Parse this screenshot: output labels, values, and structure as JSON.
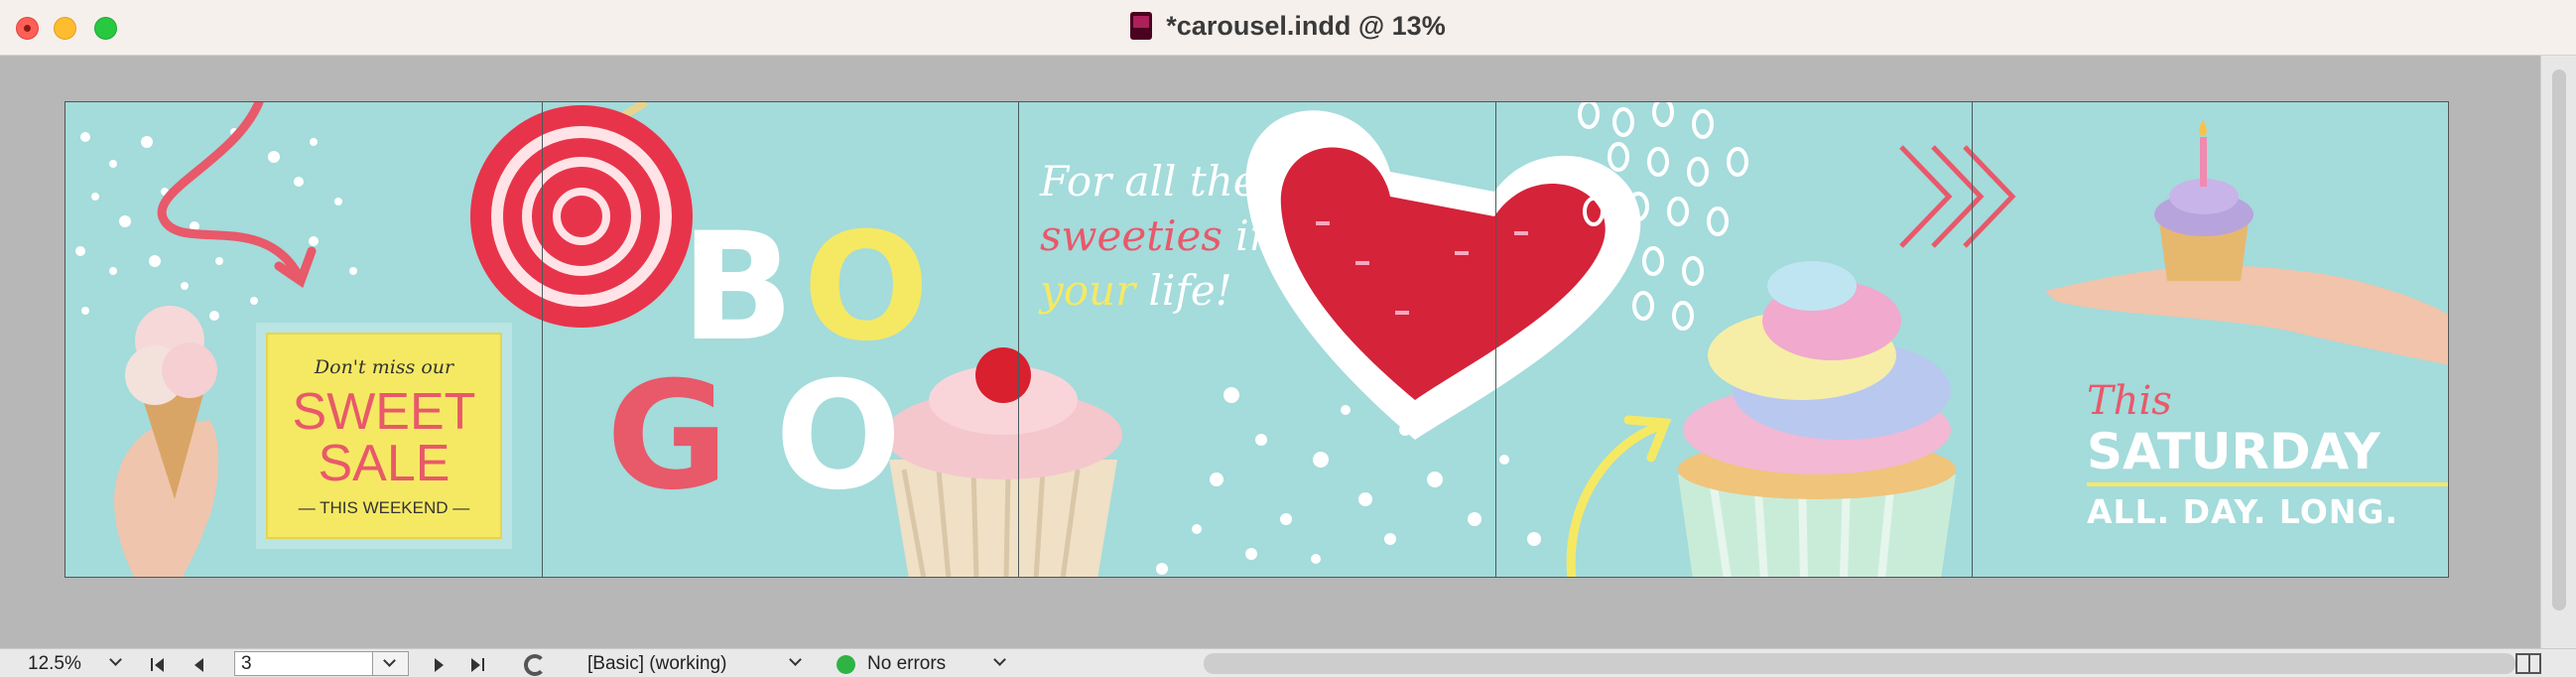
{
  "window": {
    "title": "*carousel.indd @ 13%"
  },
  "artwork": {
    "sale_card": {
      "top_line": "Don't miss our",
      "line1": "SWEET",
      "line2": "SALE",
      "bottom_line": "— THIS WEEKEND —"
    },
    "bogo": {
      "b": "B",
      "o1": "O",
      "g": "G",
      "o2": "O"
    },
    "sweeties": {
      "line1": "For all the",
      "line2a": "sweeties",
      "line2b": " in",
      "line3a": "your",
      "line3b": " life!"
    },
    "saturday": {
      "this": "This",
      "main": "SATURDAY",
      "sub": "ALL. DAY. LONG."
    }
  },
  "statusbar": {
    "zoom": "12.5%",
    "page": "3",
    "preflight_profile": "[Basic] (working)",
    "errors": "No errors"
  },
  "colors": {
    "background": "#a4dbdb",
    "pink": "#e8596a",
    "yellow": "#f5e963",
    "white": "#ffffff"
  }
}
